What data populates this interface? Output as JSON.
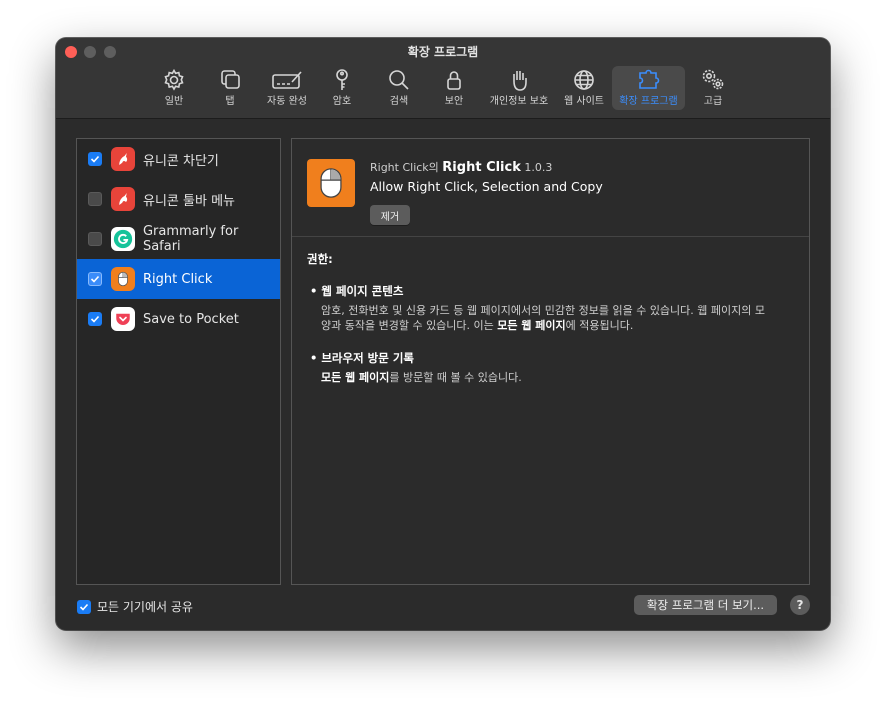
{
  "window": {
    "title": "확장 프로그램"
  },
  "toolbar": {
    "tabs": [
      {
        "label": "일반",
        "icon": "gear-icon"
      },
      {
        "label": "탭",
        "icon": "tabs-icon"
      },
      {
        "label": "자동 완성",
        "icon": "autofill-icon"
      },
      {
        "label": "암호",
        "icon": "key-icon"
      },
      {
        "label": "검색",
        "icon": "search-icon"
      },
      {
        "label": "보안",
        "icon": "lock-icon"
      },
      {
        "label": "개인정보 보호",
        "icon": "hand-icon"
      },
      {
        "label": "웹 사이트",
        "icon": "globe-icon"
      },
      {
        "label": "확장 프로그램",
        "icon": "puzzle-icon"
      },
      {
        "label": "고급",
        "icon": "gears-icon"
      }
    ],
    "active_tab": "확장 프로그램"
  },
  "extensions": [
    {
      "name": "유니콘 차단기",
      "enabled": true,
      "icon": "unicorn-icon"
    },
    {
      "name": "유니콘 툴바 메뉴",
      "enabled": false,
      "icon": "unicorn-icon"
    },
    {
      "name": "Grammarly for Safari",
      "enabled": false,
      "icon": "grammarly-icon"
    },
    {
      "name": "Right Click",
      "enabled": true,
      "icon": "mouse-icon",
      "selected": true
    },
    {
      "name": "Save to Pocket",
      "enabled": true,
      "icon": "pocket-icon"
    }
  ],
  "detail": {
    "developer_prefix": "Right Click의",
    "name": "Right Click",
    "version": "1.0.3",
    "description": "Allow Right Click, Selection and Copy",
    "remove_label": "제거",
    "permissions_heading": "권한:",
    "permissions": [
      {
        "title": "• 웹 페이지 콘텐츠",
        "text_line1": "암호, 전화번호 및 신용 카드 등 웹 페이지에서의 민감한 정보를 읽을 수 있습니다. 웹 페이지의 모",
        "text_line2_prefix": "양과 동작을 변경할 수 있습니다. 이는 ",
        "text_line2_bold": "모든 웹 페이지",
        "text_line2_suffix": "에 적용됩니다."
      },
      {
        "title": "• 브라우저 방문 기록",
        "text_bold": "모든 웹 페이지",
        "text_suffix": "를 방문할 때 볼 수 있습니다."
      }
    ]
  },
  "footer": {
    "share_label": "모든 기기에서 공유",
    "share_checked": true,
    "more_label": "확장 프로그램 더 보기...",
    "help_label": "?"
  },
  "colors": {
    "accent": "#3b8efe",
    "selection": "#0a64d6",
    "close": "#ff5f57"
  }
}
